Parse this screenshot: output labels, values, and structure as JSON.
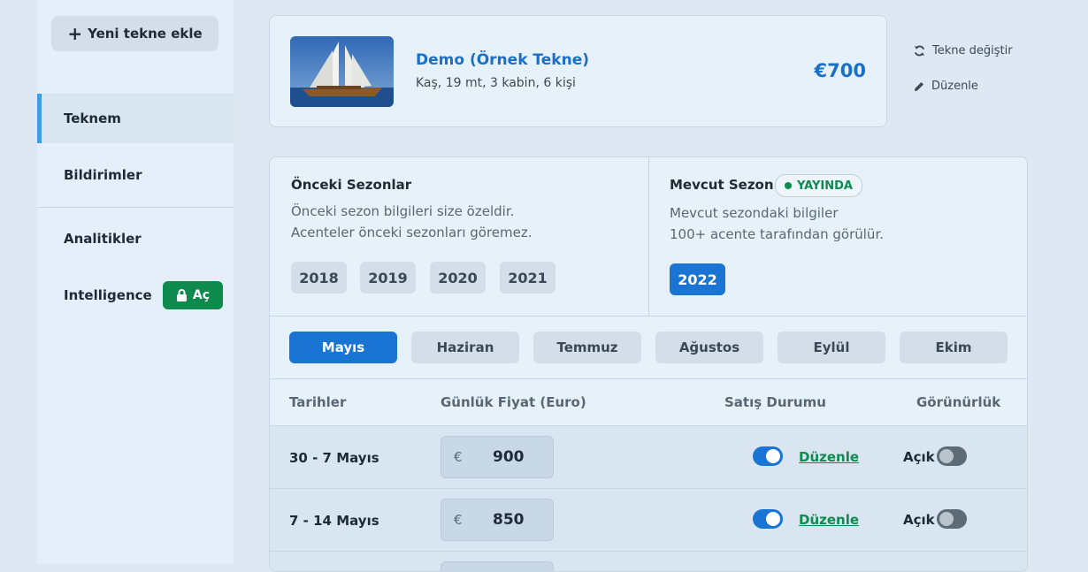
{
  "sidebar": {
    "add_button_label": "Yeni tekne ekle",
    "items": [
      {
        "label": "Teknem",
        "active": true
      },
      {
        "label": "Bildirimler"
      },
      {
        "label": "Analitikler"
      },
      {
        "label": "Intelligence",
        "badge": "Aç"
      }
    ]
  },
  "boat": {
    "name": "Demo (Örnek Tekne)",
    "meta": "Kaş, 19 mt, 3 kabin, 6 kişi",
    "price": "€700"
  },
  "actions": {
    "change_boat": "Tekne değiştir",
    "edit": "Düzenle"
  },
  "seasons": {
    "previous": {
      "title": "Önceki Sezonlar",
      "line1": "Önceki sezon bilgileri size özeldir.",
      "line2": "Acenteler önceki sezonları göremez.",
      "years": [
        "2018",
        "2019",
        "2020",
        "2021"
      ]
    },
    "current": {
      "title": "Mevcut Sezon",
      "badge": "YAYINDA",
      "line1": "Mevcut sezondaki bilgiler",
      "line2": "100+ acente tarafından görülür.",
      "year": "2022"
    }
  },
  "months": [
    "Mayıs",
    "Haziran",
    "Temmuz",
    "Ağustos",
    "Eylül",
    "Ekim"
  ],
  "active_month": "Mayıs",
  "table": {
    "headers": {
      "dates": "Tarihler",
      "price": "Günlük Fiyat (Euro)",
      "sale": "Satış Durumu",
      "visibility": "Görünürlük"
    },
    "rows": [
      {
        "dates": "30 - 7 Mayıs",
        "currency": "€",
        "price": "900",
        "edit": "Düzenle",
        "visibility": "Açık",
        "sale_on": true,
        "visible_on": false
      },
      {
        "dates": "7 - 14 Mayıs",
        "currency": "€",
        "price": "850",
        "edit": "Düzenle",
        "visibility": "Açık",
        "sale_on": true,
        "visible_on": false
      }
    ]
  },
  "colors": {
    "accent": "#1a74d3",
    "success": "#0e8a4f",
    "background": "#dde8f2"
  }
}
